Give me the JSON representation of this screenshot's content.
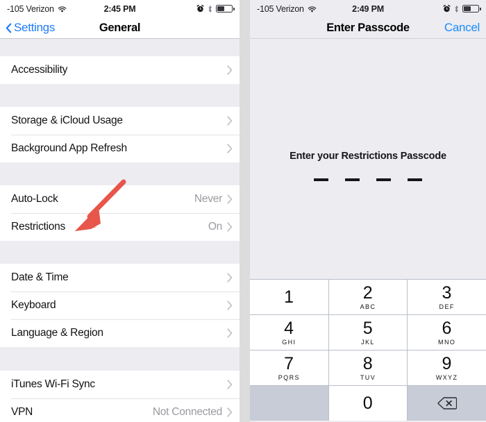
{
  "left_screen": {
    "status_bar": {
      "carrier": "-105 Verizon",
      "wifi_icon": "wifi-icon",
      "time": "2:45 PM",
      "alarm_icon": "alarm-clock-icon",
      "bluetooth_icon": "bluetooth-icon",
      "battery_icon": "battery-icon"
    },
    "nav": {
      "back_label": "Settings",
      "back_icon": "chevron-left-icon",
      "title": "General"
    },
    "groups": [
      {
        "rows": [
          {
            "label": "Accessibility",
            "value": "",
            "accessory": "chevron-right-icon"
          }
        ]
      },
      {
        "rows": [
          {
            "label": "Storage & iCloud Usage",
            "value": "",
            "accessory": "chevron-right-icon"
          },
          {
            "label": "Background App Refresh",
            "value": "",
            "accessory": "chevron-right-icon"
          }
        ]
      },
      {
        "rows": [
          {
            "label": "Auto-Lock",
            "value": "Never",
            "accessory": "chevron-right-icon"
          },
          {
            "label": "Restrictions",
            "value": "On",
            "accessory": "chevron-right-icon"
          }
        ]
      },
      {
        "rows": [
          {
            "label": "Date & Time",
            "value": "",
            "accessory": "chevron-right-icon"
          },
          {
            "label": "Keyboard",
            "value": "",
            "accessory": "chevron-right-icon"
          },
          {
            "label": "Language & Region",
            "value": "",
            "accessory": "chevron-right-icon"
          }
        ]
      },
      {
        "rows": [
          {
            "label": "iTunes Wi-Fi Sync",
            "value": "",
            "accessory": "chevron-right-icon"
          },
          {
            "label": "VPN",
            "value": "Not Connected",
            "accessory": "chevron-right-icon"
          }
        ]
      }
    ]
  },
  "right_screen": {
    "status_bar": {
      "carrier": "-105 Verizon",
      "wifi_icon": "wifi-icon",
      "time": "2:49 PM",
      "alarm_icon": "alarm-clock-icon",
      "bluetooth_icon": "bluetooth-icon",
      "battery_icon": "battery-icon"
    },
    "nav": {
      "title": "Enter Passcode",
      "cancel_label": "Cancel"
    },
    "prompt": "Enter your Restrictions Passcode",
    "passcode_length": 4,
    "entered_digits": 0,
    "keypad": [
      {
        "num": "1",
        "letters": ""
      },
      {
        "num": "2",
        "letters": "ABC"
      },
      {
        "num": "3",
        "letters": "DEF"
      },
      {
        "num": "4",
        "letters": "GHI"
      },
      {
        "num": "5",
        "letters": "JKL"
      },
      {
        "num": "6",
        "letters": "MNO"
      },
      {
        "num": "7",
        "letters": "PQRS"
      },
      {
        "num": "8",
        "letters": "TUV"
      },
      {
        "num": "9",
        "letters": "WXYZ"
      },
      {
        "num": "",
        "letters": "",
        "kind": "blank"
      },
      {
        "num": "0",
        "letters": ""
      },
      {
        "num": "",
        "letters": "",
        "kind": "delete",
        "icon": "delete-backward-icon"
      }
    ]
  },
  "annotation": {
    "arrow_icon": "arrow-pointer-icon",
    "arrow_color": "#e8554a",
    "points_to": "Restrictions"
  },
  "colors": {
    "accent_blue": "#1d7df7",
    "table_bg": "#ececf1",
    "row_bg": "#ffffff",
    "value_gray": "#9a9aa0",
    "keypad_gray": "#c7ccd6"
  }
}
